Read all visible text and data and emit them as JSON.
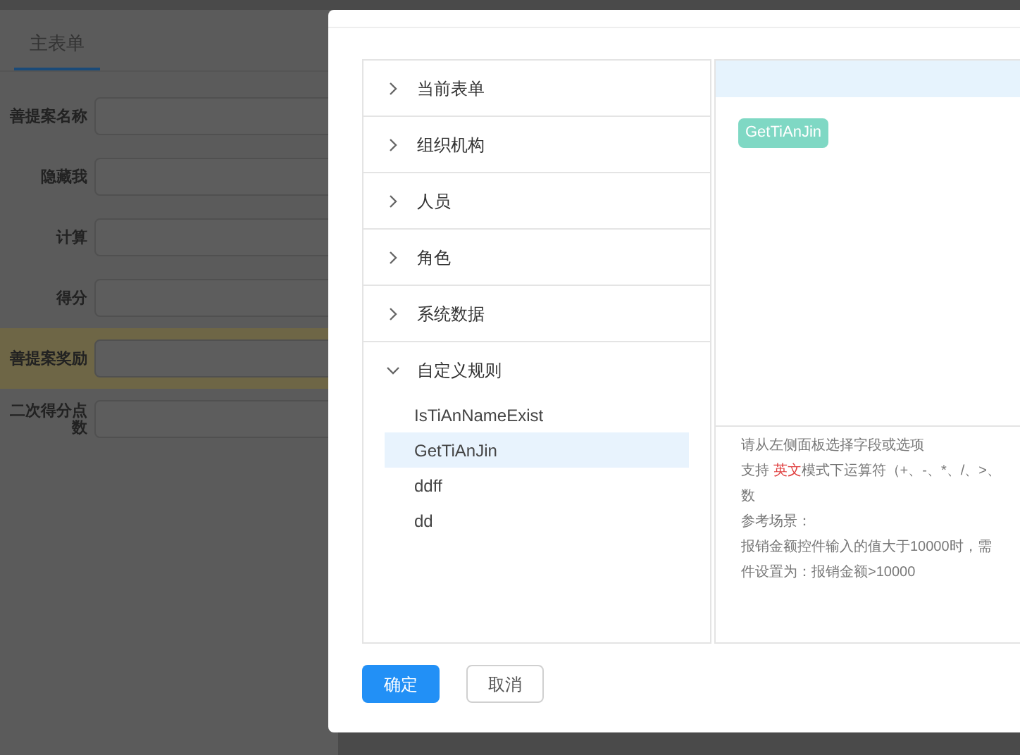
{
  "page": {
    "tab": "主表单",
    "fields": [
      {
        "label": "善提案名称",
        "highlighted": false
      },
      {
        "label": "隐藏我",
        "highlighted": false
      },
      {
        "label": "计算",
        "highlighted": false
      },
      {
        "label": "得分",
        "highlighted": false
      },
      {
        "label": "善提案奖励",
        "highlighted": true
      },
      {
        "label": "二次得分点数",
        "highlighted": false
      }
    ]
  },
  "dialog": {
    "sections": [
      {
        "title": "当前表单",
        "expanded": false
      },
      {
        "title": "组织机构",
        "expanded": false
      },
      {
        "title": "人员",
        "expanded": false
      },
      {
        "title": "角色",
        "expanded": false
      },
      {
        "title": "系统数据",
        "expanded": false
      },
      {
        "title": "自定义规则",
        "expanded": true,
        "items": [
          {
            "label": "IsTiAnNameExist",
            "selected": false
          },
          {
            "label": "GetTiAnJin",
            "selected": true
          },
          {
            "label": "ddff",
            "selected": false
          },
          {
            "label": "dd",
            "selected": false
          }
        ]
      }
    ],
    "formula_tag": "GetTiAnJin",
    "help": [
      [
        {
          "text": "请从左侧面板选择字段或选项",
          "highlight": false
        }
      ],
      [
        {
          "text": "支持 ",
          "highlight": false
        },
        {
          "text": "英文",
          "highlight": true
        },
        {
          "text": "模式下运算符（+、-、*、/、>、",
          "highlight": false
        }
      ],
      [
        {
          "text": "数",
          "highlight": false
        }
      ],
      [
        {
          "text": "参考场景：",
          "highlight": false
        }
      ],
      [
        {
          "text": "报销金额控件输入的值大于10000时，需",
          "highlight": false
        }
      ],
      [
        {
          "text": "件设置为：报销金额>10000",
          "highlight": false
        }
      ]
    ],
    "buttons": [
      {
        "label": "确定",
        "kind": "primary"
      },
      {
        "label": "取消",
        "kind": "default"
      }
    ]
  }
}
